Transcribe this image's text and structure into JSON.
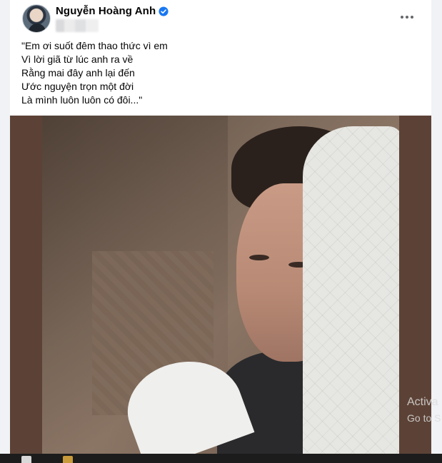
{
  "post": {
    "author": "Nguyễn Hoàng Anh",
    "lines": [
      "\"Em ơi suốt đêm thao thức vì em",
      "Vì lời giã từ lúc anh ra về",
      "Rằng mai đây anh lại đến",
      "Ước nguyện trọn một đời",
      "Là mình luôn luôn có đôi...\""
    ]
  },
  "watermark": {
    "line1": "Activa",
    "line2": "Go to S"
  },
  "icons": {
    "verified": "verified-badge-icon",
    "more": "more-options-icon"
  },
  "colors": {
    "verified": "#1877f2",
    "photo_bg": "#5c4236"
  }
}
